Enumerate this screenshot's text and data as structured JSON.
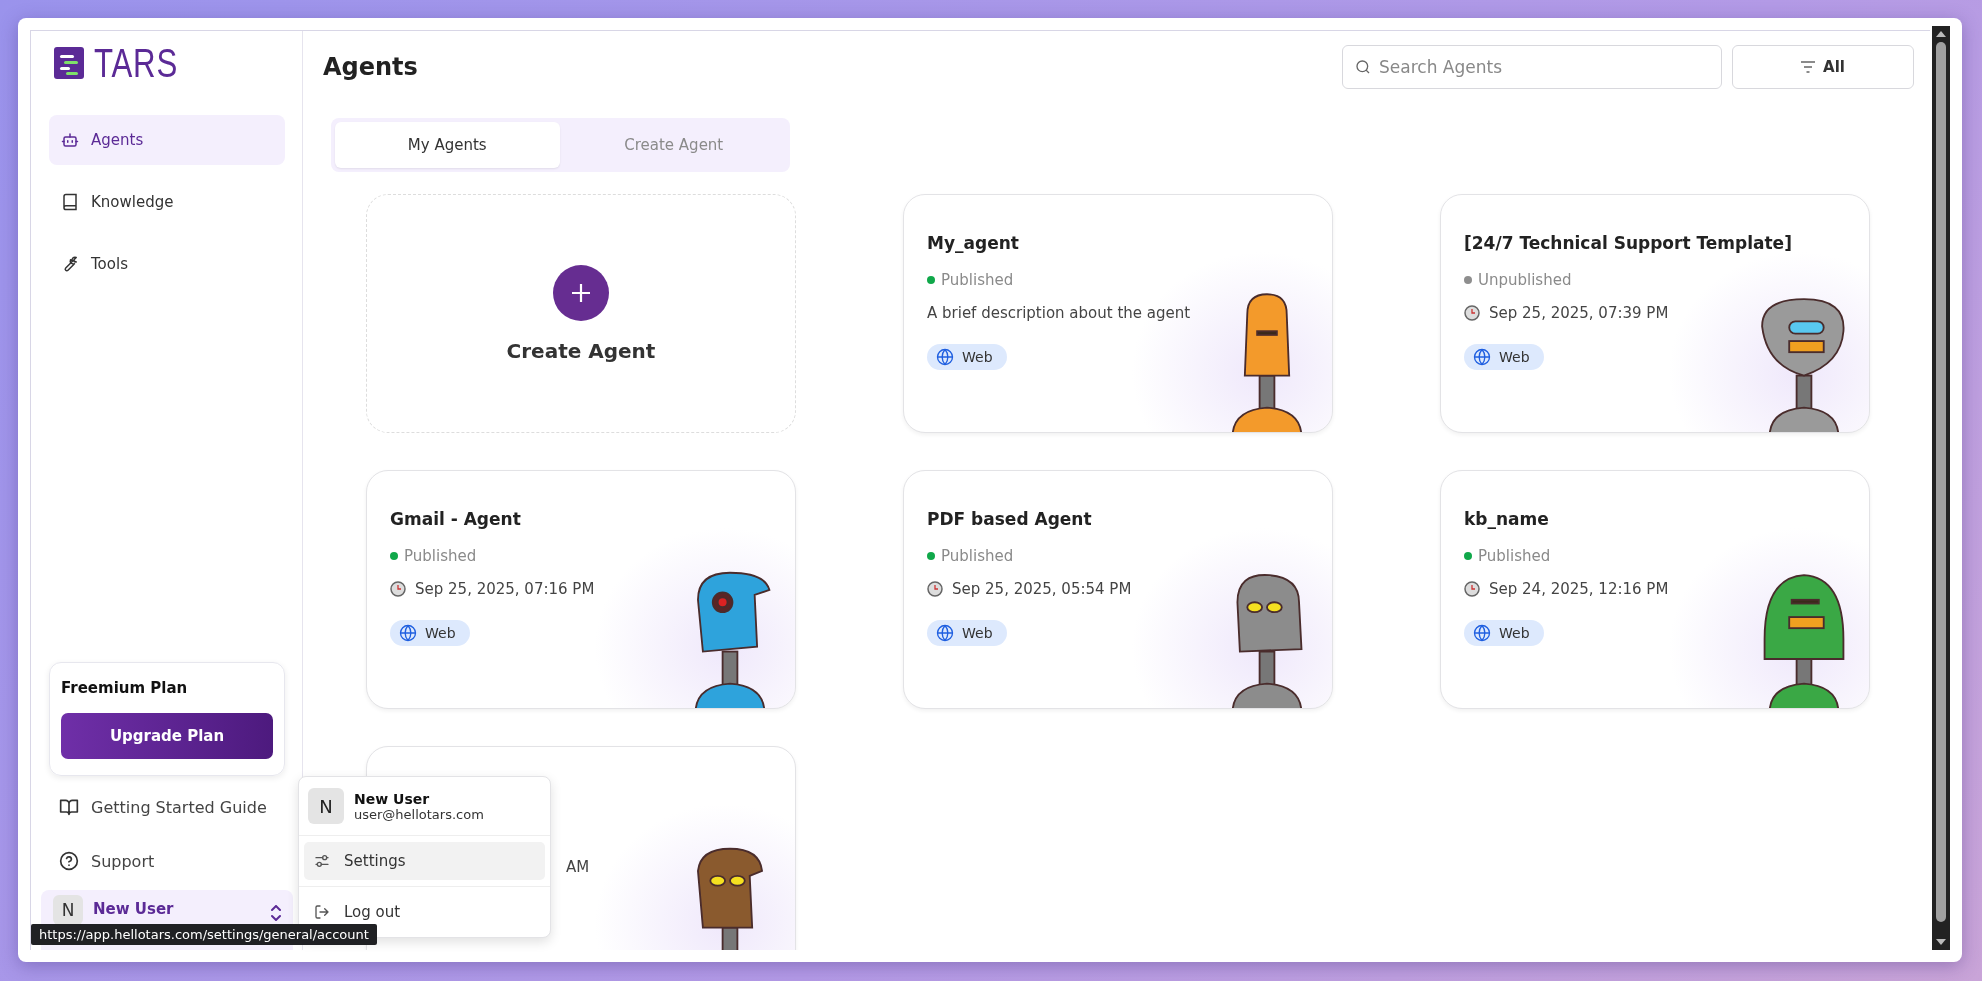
{
  "sidebar": {
    "logo": "TARS",
    "nav": [
      {
        "label": "Agents",
        "selected": true
      },
      {
        "label": "Knowledge",
        "selected": false
      },
      {
        "label": "Tools",
        "selected": false
      }
    ],
    "plan": {
      "title": "Freemium Plan",
      "button": "Upgrade Plan"
    },
    "links": [
      {
        "label": "Getting Started Guide"
      },
      {
        "label": "Support"
      }
    ],
    "user": {
      "initial": "N",
      "name": "New User"
    }
  },
  "header": {
    "title": "Agents",
    "search": {
      "placeholder": "Search Agents"
    },
    "filter": "All"
  },
  "tabs": [
    {
      "label": "My Agents",
      "selected": true
    },
    {
      "label": "Create Agent",
      "selected": false
    }
  ],
  "create_card": {
    "label": "Create Agent"
  },
  "agents": [
    {
      "kind": "agent",
      "name": "My_agent",
      "published": true,
      "status": "Published",
      "description": "A brief description about the agent",
      "channels": [
        "Web"
      ],
      "color": "#f39a2b"
    },
    {
      "kind": "agent",
      "name": "[24/7 Technical Support Template]",
      "published": false,
      "status": "Unpublished",
      "date": "Sep 25, 2025, 07:39 PM",
      "channels": [
        "Web"
      ],
      "color": "#9a9a9a"
    },
    {
      "kind": "agent",
      "name": "Gmail - Agent",
      "published": true,
      "status": "Published",
      "date": "Sep 25, 2025, 07:16 PM",
      "channels": [
        "Web"
      ],
      "color": "#2ea3dc"
    },
    {
      "kind": "agent",
      "name": "PDF based Agent",
      "published": true,
      "status": "Published",
      "date": "Sep 25, 2025, 05:54 PM",
      "channels": [
        "Web"
      ],
      "color": "#8c8c8c"
    },
    {
      "kind": "agent",
      "name": "kb_name",
      "published": true,
      "status": "Published",
      "date": "Sep 24, 2025, 12:16 PM",
      "channels": [
        "Web"
      ],
      "color": "#3aa845"
    },
    {
      "kind": "covered",
      "date": "AM",
      "color": "#8a5a2e"
    }
  ],
  "menu": {
    "user": {
      "initial": "N",
      "name": "New User",
      "email": "user@hellotars.com"
    },
    "items": [
      {
        "label": "Settings",
        "selected": true
      },
      {
        "label": "Log out",
        "selected": false
      }
    ]
  },
  "tooltip": "https://app.hellotars.com/settings/general/account"
}
